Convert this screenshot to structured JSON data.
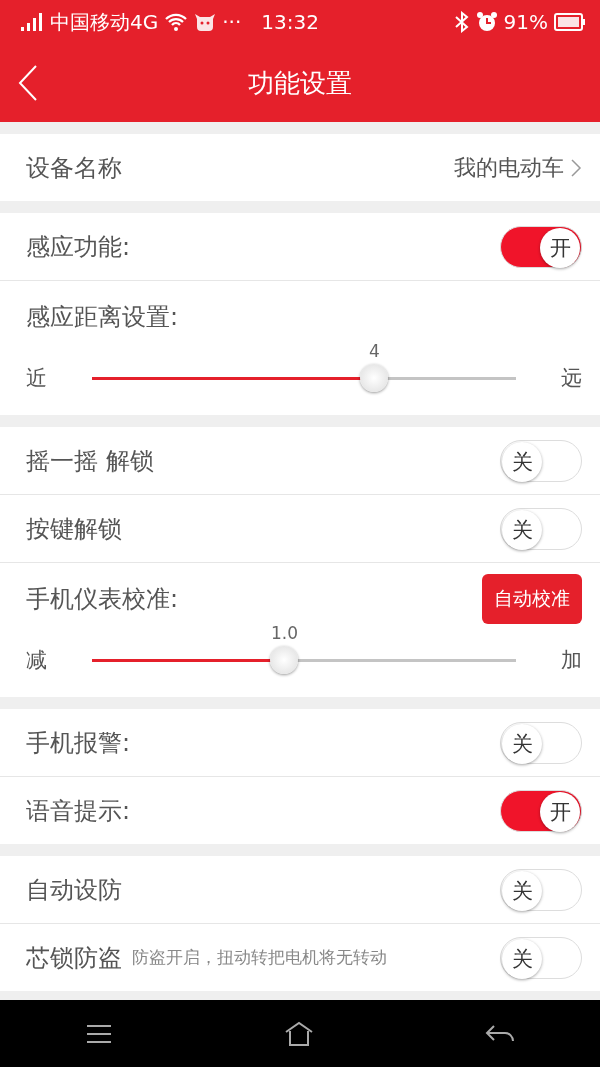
{
  "status_bar": {
    "carrier": "中国移动4G",
    "dots": "···",
    "time": "13:32",
    "battery": "91%"
  },
  "header": {
    "title": "功能设置"
  },
  "sections": [
    {
      "rows": [
        {
          "kind": "link",
          "label": "设备名称",
          "value": "我的电动车"
        }
      ]
    },
    {
      "rows": [
        {
          "kind": "toggle",
          "label": "感应功能:",
          "on": true,
          "text": "开"
        },
        {
          "kind": "slider",
          "label": "感应距离设置:",
          "min_label": "近",
          "max_label": "远",
          "reading": "4",
          "level": 0.666
        }
      ]
    },
    {
      "rows": [
        {
          "kind": "toggle",
          "label": "摇一摇 解锁",
          "on": false,
          "text": "关"
        },
        {
          "kind": "toggle",
          "label": "按键解锁",
          "on": false,
          "text": "关"
        },
        {
          "kind": "slider",
          "label": "手机仪表校准:",
          "button": "自动校准",
          "min_label": "减",
          "max_label": "加",
          "reading": "1.0",
          "level": 0.454
        }
      ]
    },
    {
      "rows": [
        {
          "kind": "toggle",
          "label": "手机报警:",
          "on": false,
          "text": "关"
        },
        {
          "kind": "toggle",
          "label": "语音提示:",
          "on": true,
          "text": "开"
        }
      ]
    },
    {
      "rows": [
        {
          "kind": "toggle",
          "label": "自动设防",
          "on": false,
          "text": "关"
        },
        {
          "kind": "toggle",
          "label": "芯锁防盗",
          "note": "防盗开启，扭动转把电机将无转动",
          "on": false,
          "text": "关"
        }
      ]
    }
  ]
}
